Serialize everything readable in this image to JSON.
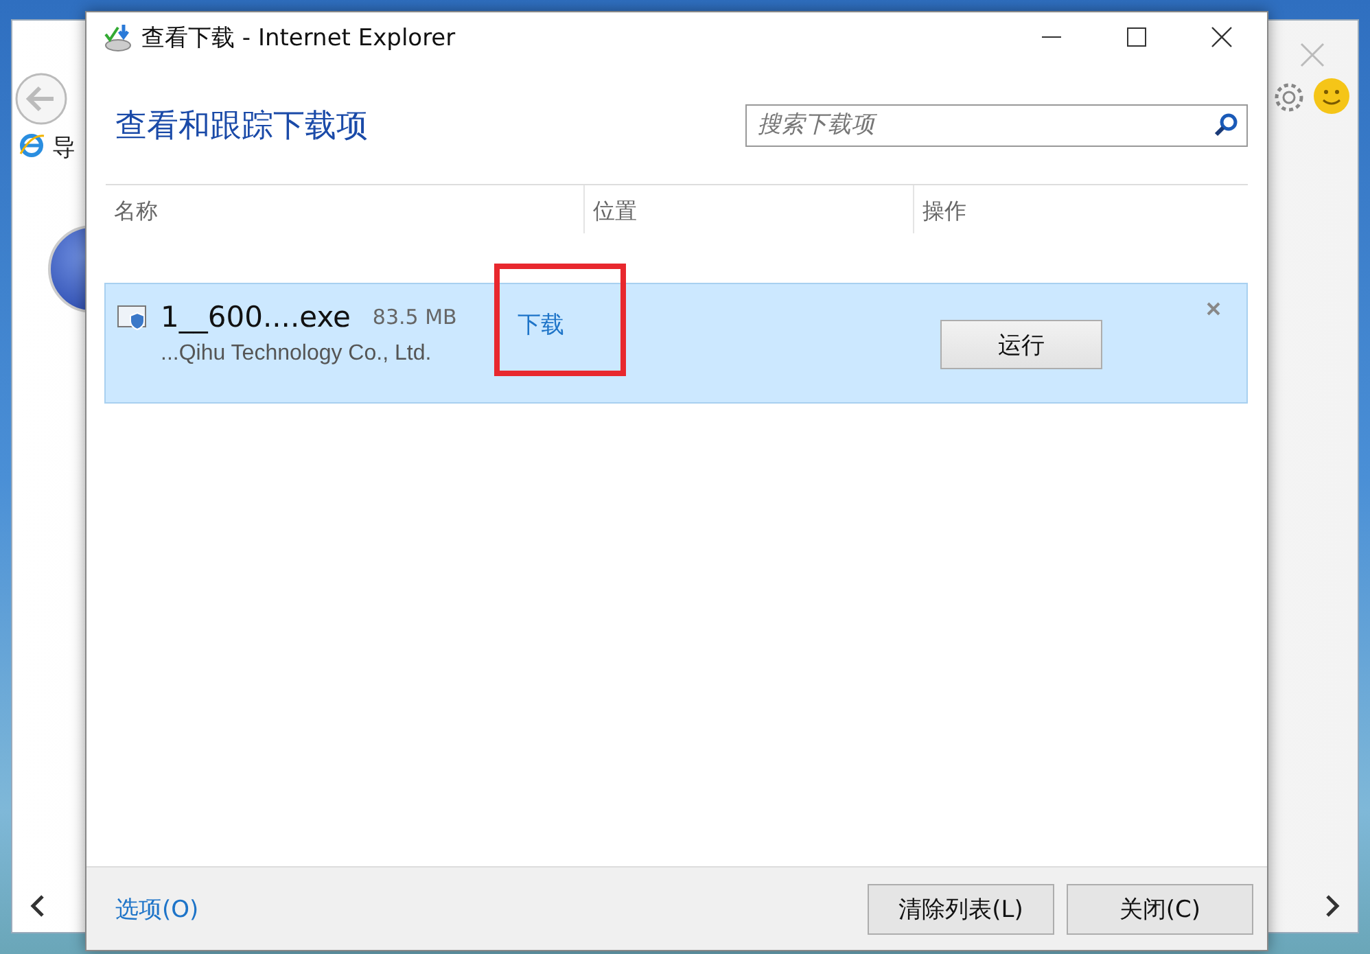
{
  "background_browser": {
    "tab_label": "导"
  },
  "window": {
    "title": "查看下载 - Internet Explorer"
  },
  "heading": "查看和跟踪下载项",
  "search": {
    "placeholder": "搜索下载项"
  },
  "columns": [
    "名称",
    "位置",
    "操作"
  ],
  "downloads": [
    {
      "name": "1__600....exe",
      "size": "83.5 MB",
      "publisher": "...Qihu Technology Co., Ltd.",
      "location": "下载",
      "action": "运行",
      "selected": true,
      "highlighted": true
    }
  ],
  "footer": {
    "options_link": "选项(O)",
    "buttons": [
      "清除列表(L)",
      "关闭(C)"
    ]
  }
}
